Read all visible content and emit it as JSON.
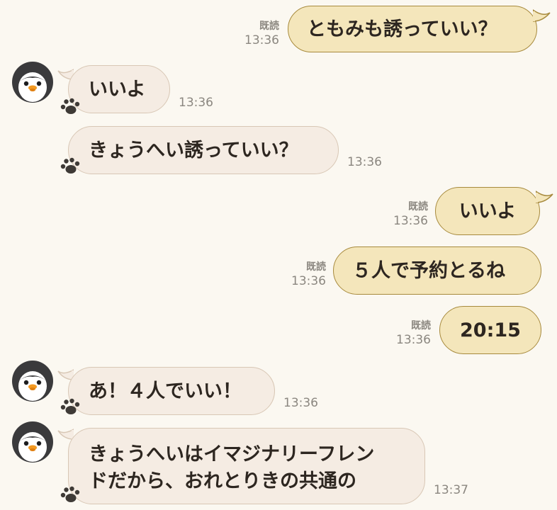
{
  "messages": [
    {
      "side": "out",
      "text": "ともみも誘っていい？",
      "read": "既読",
      "time": "13:36"
    },
    {
      "side": "in",
      "text": "いいよ",
      "time": "13:36"
    },
    {
      "side": "in",
      "text": "きょうへい誘っていい？",
      "time": "13:36"
    },
    {
      "side": "out",
      "text": "いいよ",
      "read": "既読",
      "time": "13:36"
    },
    {
      "side": "out",
      "text": "５人で予約とるね",
      "read": "既読",
      "time": "13:36"
    },
    {
      "side": "out",
      "text": "20:15",
      "read": "既読",
      "time": "13:36"
    },
    {
      "side": "in",
      "text": "あ！４人でいい！",
      "time": "13:36"
    },
    {
      "side": "in",
      "lines": [
        "きょうへいはイマジナリーフレン",
        "ドだから、おれとりきの共通の"
      ],
      "time": "13:37"
    }
  ],
  "icons": {
    "avatar": "penguin-avatar-icon",
    "paw": "paw-icon"
  },
  "colors": {
    "background": "#fbf8f1",
    "outgoing_bubble": "#f4e6bb",
    "outgoing_border": "#a78a3d",
    "incoming_bubble": "#f5ece3",
    "incoming_border": "#d8c7b5",
    "meta_text": "#8b8780"
  }
}
